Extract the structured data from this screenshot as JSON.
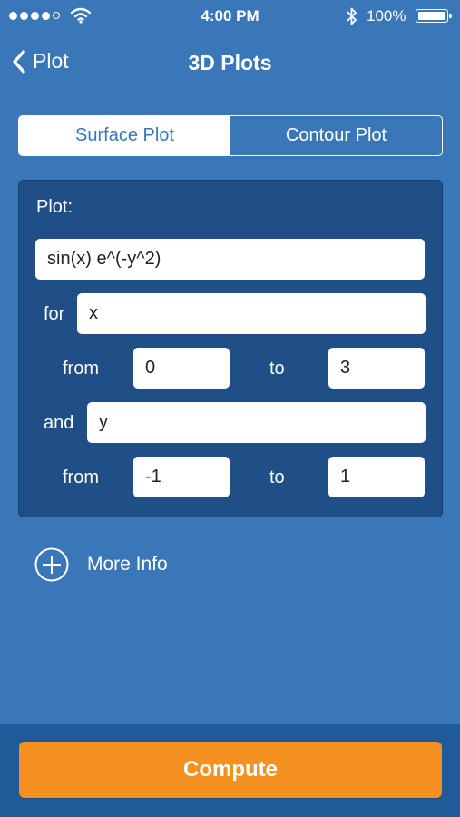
{
  "status_bar": {
    "time": "4:00 PM",
    "battery_percent": "100%",
    "signal_bars": 4,
    "signal_total": 5,
    "icons": [
      "signal-dots-icon",
      "wifi-icon",
      "bluetooth-icon",
      "battery-icon"
    ]
  },
  "nav": {
    "back_label": "Plot",
    "title": "3D Plots",
    "back_icon": "chevron-left-icon"
  },
  "segments": {
    "selected": "Surface Plot",
    "items": [
      "Surface Plot",
      "Contour Plot"
    ]
  },
  "form": {
    "plot_label": "Plot:",
    "function_value": "sin(x) e^(-y^2)",
    "for_label": "for",
    "x_var": "x",
    "x_from_label": "from",
    "x_from": "0",
    "x_to_label": "to",
    "x_to": "3",
    "and_label": "and",
    "y_var": "y",
    "y_from_label": "from",
    "y_from": "-1",
    "y_to_label": "to",
    "y_to": "1"
  },
  "more_info": {
    "label": "More Info",
    "icon": "plus-circle-icon"
  },
  "footer": {
    "compute_label": "Compute"
  },
  "colors": {
    "background": "#3a77b8",
    "panel": "#1f4f86",
    "footer": "#1f5a99",
    "compute": "#f39221"
  }
}
